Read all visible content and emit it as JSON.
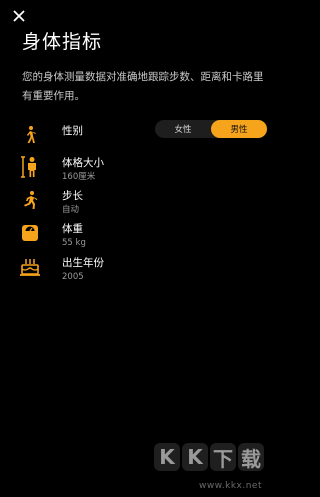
{
  "header": {
    "close_icon": "close-icon",
    "title": "身体指标"
  },
  "description": "您的身体测量数据对准确地跟踪步数、距离和卡路里有重要作用。",
  "rows": [
    {
      "id": "gender",
      "icon": "walking-person-icon",
      "label": "性别",
      "options": [
        "女性",
        "男性"
      ],
      "selected": "男性"
    },
    {
      "id": "body-size",
      "icon": "person-height-icon",
      "label": "体格大小",
      "value": "160厘米"
    },
    {
      "id": "stride",
      "icon": "running-person-icon",
      "label": "步长",
      "value": "自动"
    },
    {
      "id": "weight",
      "icon": "scale-icon",
      "label": "体重",
      "value": "55 kg"
    },
    {
      "id": "birth-year",
      "icon": "cake-icon",
      "label": "出生年份",
      "value": "2005"
    }
  ],
  "colors": {
    "accent": "#f7a41d",
    "background": "#000000",
    "toggle_inactive": "#1e1e1e"
  },
  "watermark": {
    "chars": [
      "K",
      "K",
      "下",
      "载"
    ],
    "url": "www.kkx.net"
  }
}
